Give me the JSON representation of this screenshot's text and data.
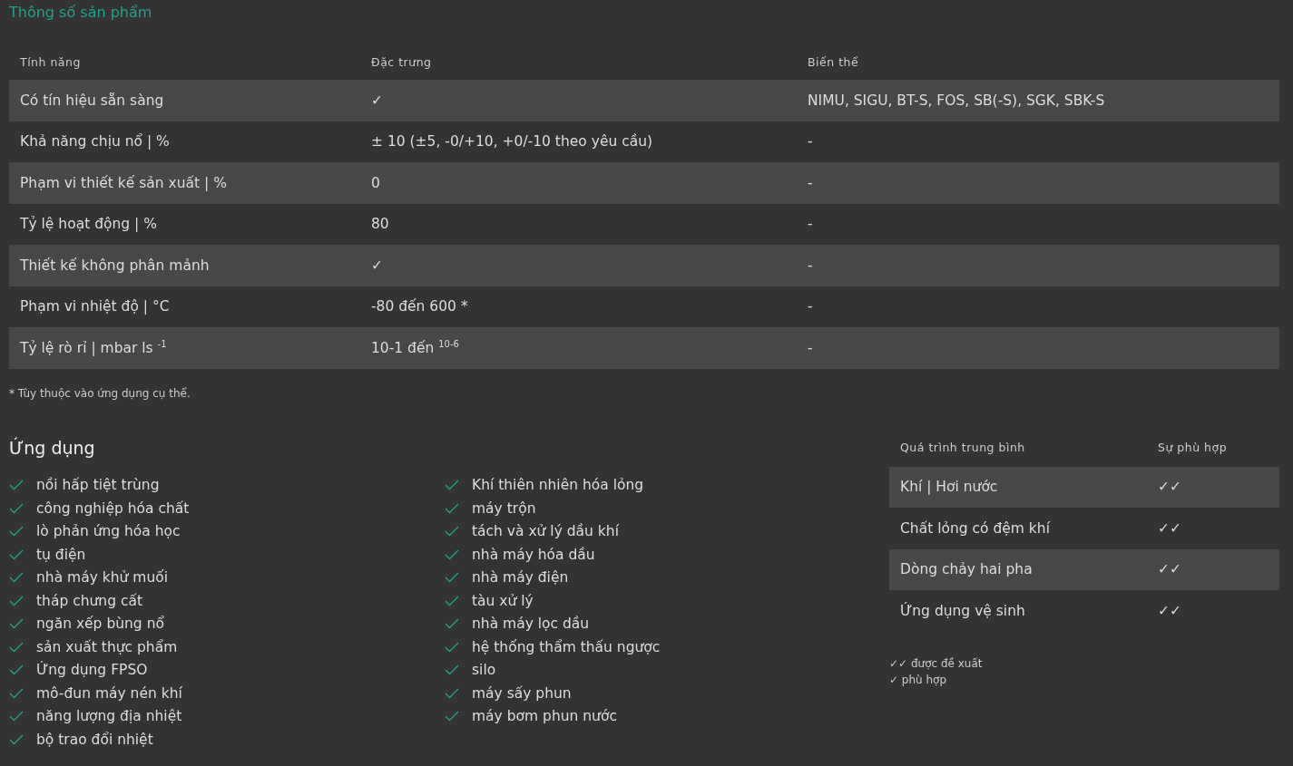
{
  "title": "Thông số sản phẩm",
  "spec_table": {
    "columns": [
      "Tính năng",
      "Đặc trưng",
      "Biến thể"
    ],
    "rows": [
      [
        "Có tín hiệu sẵn sàng",
        "✓",
        "NIMU, SIGU, BT-S, FOS, SB(-S), SGK, SBK-S"
      ],
      [
        "Khả năng chịu nổ | %",
        "± 10 (±5, -0/+10, +0/-10 theo yêu cầu)",
        "-"
      ],
      [
        "Phạm vi thiết kế sản xuất | %",
        "0",
        "-"
      ],
      [
        "Tỷ lệ hoạt động | %",
        "80",
        "-"
      ],
      [
        "Thiết kế không phân mảnh",
        "✓",
        "-"
      ],
      [
        "Phạm vi nhiệt độ | °C",
        "-80 đến 600 *",
        "-"
      ],
      [
        "Tỷ lệ rò rỉ | mbar ls $^{-1}$",
        "10-1 đến $^{10-6}$",
        "-"
      ]
    ]
  },
  "footnote": "* Tùy thuộc vào ứng dụng cụ thể.",
  "applications": {
    "heading": "Ứng dụng",
    "columns": [
      [
        "nồi hấp tiệt trùng",
        "công nghiệp hóa chất",
        "lò phản ứng hóa học",
        "tụ điện",
        "nhà máy khử muối",
        "tháp chưng cất",
        "ngăn xếp bùng nổ",
        "sản xuất thực phẩm",
        "Ứng dụng FPSO",
        "mô-đun máy nén khí",
        "năng lượng địa nhiệt",
        "bộ trao đổi nhiệt"
      ],
      [
        "Khí thiên nhiên hóa lỏng",
        "máy trộn",
        "tách và xử lý dầu khí",
        "nhà máy hóa dầu",
        "nhà máy điện",
        "tàu xử lý",
        "nhà máy lọc dầu",
        "hệ thống thẩm thấu ngược",
        "silo",
        "máy sấy phun",
        "máy bơm phun nước"
      ]
    ]
  },
  "process_table": {
    "columns": [
      "Quá trình trung bình",
      "Sự phù hợp"
    ],
    "rows": [
      [
        "Khí | Hơi nước",
        "✓✓"
      ],
      [
        "Chất lỏng có đệm khí",
        "✓✓"
      ],
      [
        "Dòng chảy hai pha",
        "✓✓"
      ],
      [
        "Ứng dụng vệ sinh",
        "✓✓"
      ]
    ]
  },
  "legend": [
    "✓✓ được đề xuất",
    "✓ phù hợp"
  ]
}
